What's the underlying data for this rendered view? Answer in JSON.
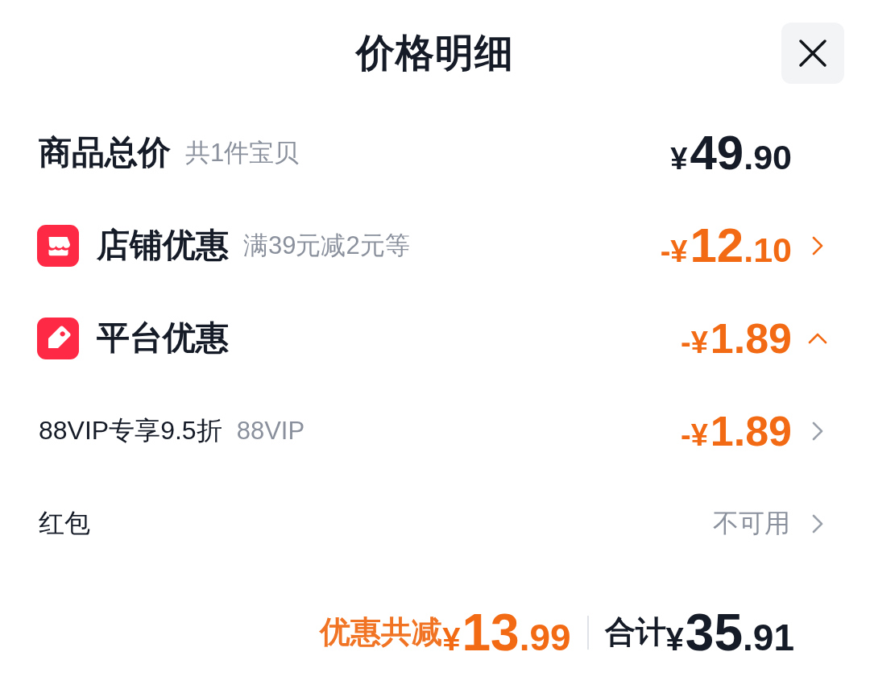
{
  "sheet": {
    "title": "价格明细"
  },
  "rows": [
    {
      "kind": "subtotal",
      "label": "商品总价",
      "note": "共1件宝贝",
      "amount": {
        "prefix": "¥",
        "whole": "49",
        "fraction": ".90"
      }
    },
    {
      "kind": "shop",
      "label": "店铺优惠",
      "note": "满39元减2元等",
      "amount": {
        "prefix": "-¥",
        "whole": "12",
        "fraction": ".10"
      },
      "expanded": false
    },
    {
      "kind": "platform",
      "label": "平台优惠",
      "amount": {
        "prefix": "-¥",
        "whole": "1.89"
      },
      "expanded": true
    },
    {
      "kind": "detail",
      "label": "88VIP专享9.5折",
      "note": "88VIP",
      "amount": {
        "prefix": "-¥",
        "whole": "1.89"
      },
      "expanded": false
    },
    {
      "kind": "detail",
      "label": "红包",
      "status": "不可用",
      "expanded": false
    }
  ],
  "summary": {
    "discount_label": "优惠共减",
    "discount_amount": {
      "prefix": "¥",
      "whole": "13",
      "fraction": ".99"
    },
    "total_label": "合计",
    "total_amount": {
      "prefix": "¥",
      "whole": "35",
      "fraction": ".91"
    }
  }
}
